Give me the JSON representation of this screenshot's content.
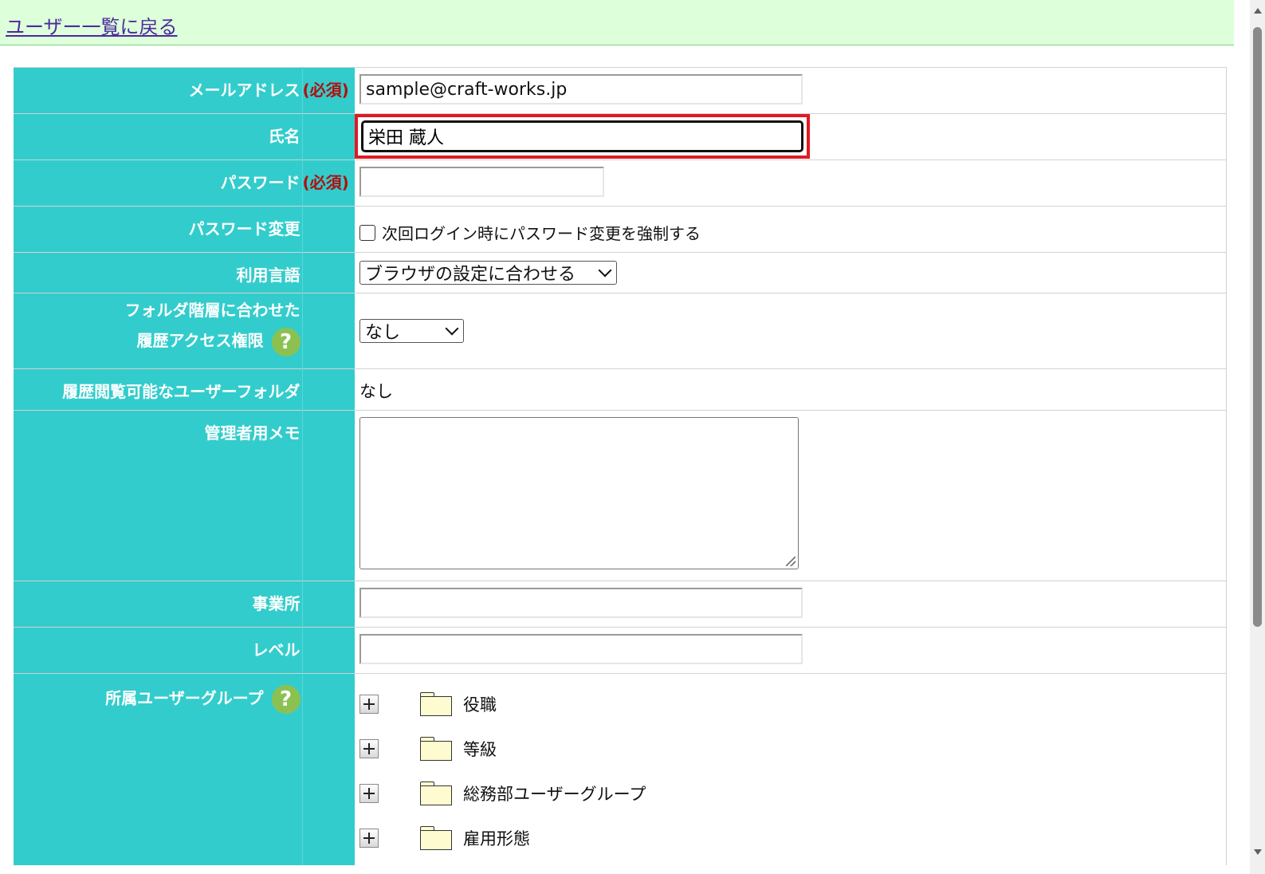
{
  "back_link": "ユーザー一覧に戻る",
  "required_mark": "(必須)",
  "fields": {
    "email": {
      "label": "メールアドレス",
      "value": "sample@craft-works.jp"
    },
    "name": {
      "label": "氏名",
      "value": "栄田 蔵人"
    },
    "password": {
      "label": "パスワード",
      "value": ""
    },
    "password_change": {
      "label": "パスワード変更",
      "checkbox_label": "次回ログイン時にパスワード変更を強制する",
      "checked": false
    },
    "language": {
      "label": "利用言語",
      "selected": "ブラウザの設定に合わせる"
    },
    "folder_access": {
      "label_line1": "フォルダ階層に合わせた",
      "label_line2": "履歴アクセス権限",
      "selected": "なし",
      "help": "?"
    },
    "viewable_folder": {
      "label": "履歴閲覧可能なユーザーフォルダ",
      "value": "なし"
    },
    "admin_memo": {
      "label": "管理者用メモ",
      "value": ""
    },
    "office": {
      "label": "事業所",
      "value": ""
    },
    "level": {
      "label": "レベル",
      "value": ""
    },
    "user_groups": {
      "label": "所属ユーザーグループ",
      "help": "?",
      "items": [
        "役職",
        "等級",
        "総務部ユーザーグループ",
        "雇用形態"
      ]
    }
  },
  "colors": {
    "label_bg": "#33cccc",
    "required": "#b01010",
    "top_bar": "#ddffd9",
    "focus_outline": "#e01a23",
    "help_icon": "#8cc152"
  }
}
